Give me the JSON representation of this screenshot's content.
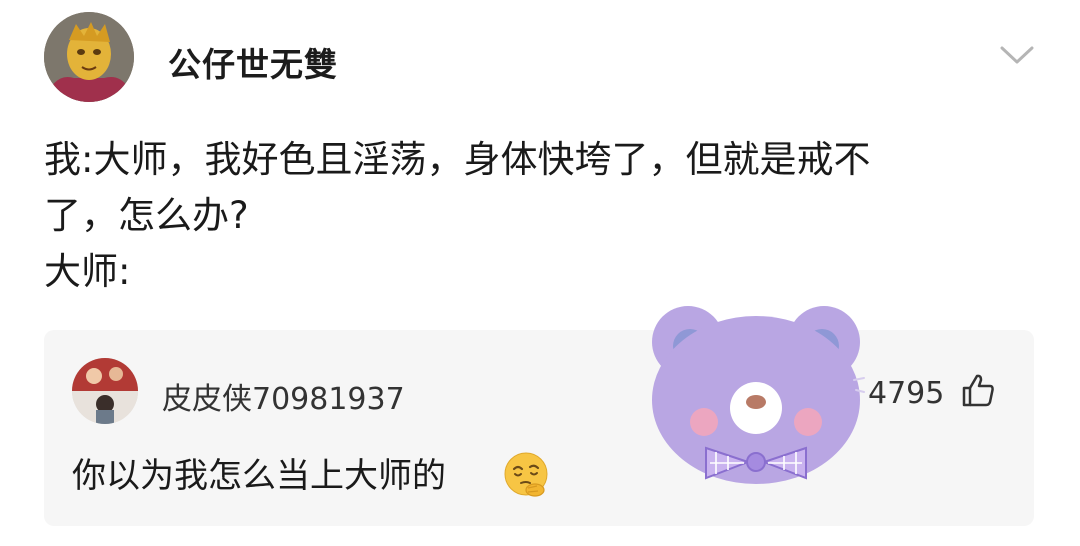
{
  "post": {
    "author": "公仔世无雙",
    "lines": [
      "我:大师，我好色且淫荡，身体快垮了，但就是戒不",
      "了，怎么办?",
      "大师:"
    ]
  },
  "comment": {
    "author": "皮皮侠70981937",
    "text": "你以为我怎么当上大师的",
    "likes": "4795"
  },
  "icons": {
    "expand": "chevron-down-icon",
    "like": "thumbs-up-icon",
    "emoji": "thinking-face-emoji",
    "sticker": "purple-bear-sticker"
  },
  "colors": {
    "card_bg": "#f6f6f6",
    "text": "#1a1a1a",
    "bear": "#b9a6e3"
  }
}
